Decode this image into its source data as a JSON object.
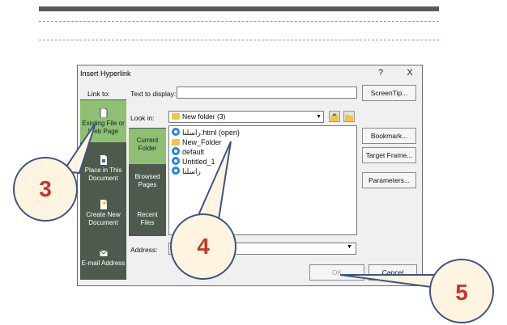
{
  "dialog": {
    "title": "Insert Hyperlink",
    "help_glyph": "?",
    "close_glyph": "X",
    "link_to_label": "Link to:",
    "text_to_display_label": "Text to display:",
    "text_to_display_value": "",
    "screentip_button": "ScreenTip...",
    "look_in_label": "Look in:",
    "look_in_value": "New folder (3)",
    "address_label": "Address:",
    "address_value": "",
    "bookmark_button": "Bookmark...",
    "target_frame_button": "Target Frame...",
    "parameters_button": "Parameters...",
    "ok_button": "OK",
    "cancel_button": "Cancel"
  },
  "sidebar": {
    "items": [
      {
        "line1": "Existing File or",
        "line2": "Web Page",
        "icon": "file-icon",
        "selected": true
      },
      {
        "line1": "Place in This",
        "line2": "Document",
        "icon": "document-place-icon",
        "selected": false
      },
      {
        "line1": "Create New",
        "line2": "Document",
        "icon": "new-document-icon",
        "selected": false
      },
      {
        "line1": "E-mail Address",
        "line2": "",
        "icon": "email-icon",
        "selected": false
      }
    ]
  },
  "inner_nav": {
    "items": [
      {
        "line1": "Current",
        "line2": "Folder",
        "selected": true
      },
      {
        "line1": "Browsed",
        "line2": "Pages",
        "selected": false
      },
      {
        "line1": "Recent",
        "line2": "Files",
        "selected": false
      }
    ]
  },
  "files": [
    {
      "name": "راسلنا.html (open)",
      "icon": "browser-icon"
    },
    {
      "name": "New_Folder",
      "icon": "folder-icon"
    },
    {
      "name": "default",
      "icon": "browser-icon"
    },
    {
      "name": "Untitled_1",
      "icon": "browser-icon"
    },
    {
      "name": "راسلنا",
      "icon": "browser-icon"
    }
  ],
  "callouts": {
    "c3": "3",
    "c4": "4",
    "c5": "5"
  },
  "colors": {
    "sidebar": "#4d5a4d",
    "selected": "#8fbf73",
    "callout_border": "#3b5583",
    "callout_fill": "#fff4e0",
    "callout_text": "#c0392b"
  }
}
